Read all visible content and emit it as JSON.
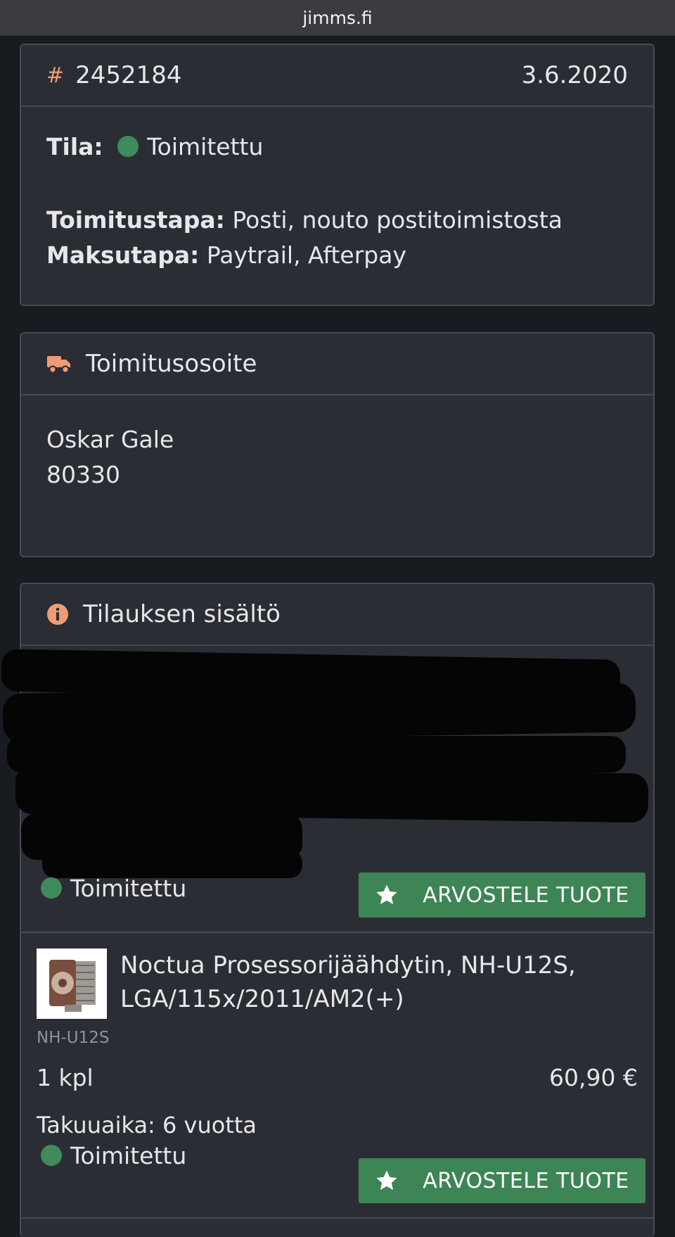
{
  "browser": {
    "domain": "jimms.fi"
  },
  "order": {
    "number": "2452184",
    "date": "3.6.2020",
    "status_label": "Tila:",
    "status_value": "Toimitettu",
    "shipping_label": "Toimitustapa:",
    "shipping_value": "Posti, nouto postitoimistosta",
    "payment_label": "Maksutapa:",
    "payment_value": "Paytrail, Afterpay"
  },
  "address": {
    "title": "Toimitusosoite",
    "name": "Oskar Gale",
    "postal_code": "80330"
  },
  "contents": {
    "title": "Tilauksen sisältö",
    "items": [
      {
        "status": "Toimitettu",
        "review_button": "ARVOSTELE TUOTE"
      },
      {
        "name_line1": "Noctua Prosessorijäähdytin, NH-U12S,",
        "name_line2": "LGA/115x/2011/AM2(+)",
        "sku": "NH-U12S",
        "quantity": "1 kpl",
        "price": "60,90 €",
        "warranty": "Takuuaika: 6 vuotta",
        "status": "Toimitettu",
        "review_button": "ARVOSTELE TUOTE"
      }
    ]
  },
  "icons": {
    "hash": "hash-icon",
    "truck": "truck-icon",
    "info": "info-icon",
    "star": "star-icon",
    "status_dot": "status-dot-icon"
  },
  "colors": {
    "accent": "#ee9c75",
    "success": "#3f8b5b",
    "button": "#3d8555",
    "card": "#2b2d35",
    "background": "#181b20"
  }
}
